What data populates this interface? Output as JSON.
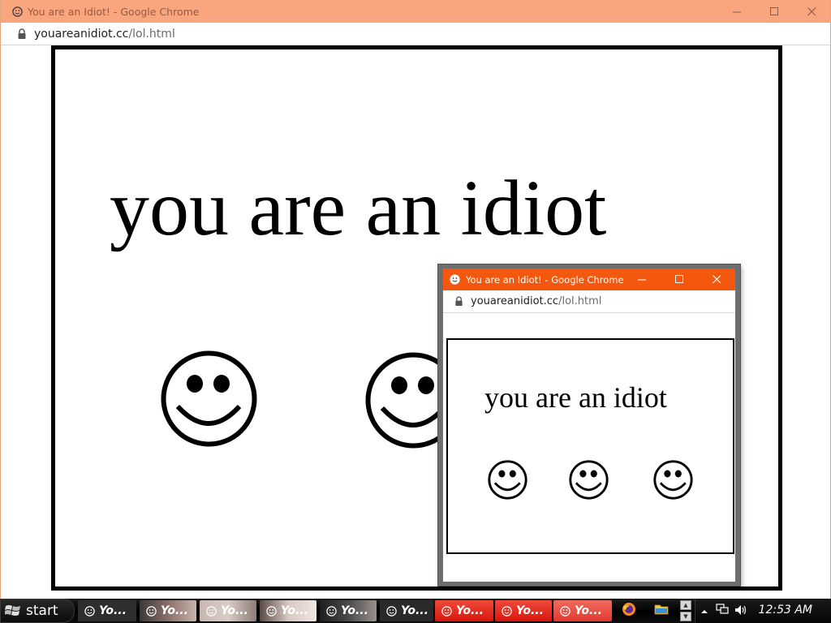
{
  "main_window": {
    "title": "You are an Idiot! - Google Chrome",
    "url_host": "youareanidiot.cc",
    "url_path": "/lol.html",
    "message": "you are an idiot"
  },
  "popup_window": {
    "title": "You are an Idiot! - Google Chrome",
    "url_host": "youareanidiot.cc",
    "url_path": "/lol.html",
    "message": "you are an idiot"
  },
  "taskbar": {
    "start_label": "start",
    "tasks": [
      {
        "label": "Yo...",
        "active": false
      },
      {
        "label": "Yo...",
        "active": false
      },
      {
        "label": "Yo...",
        "active": false
      },
      {
        "label": "Yo...",
        "active": false
      },
      {
        "label": "Yo...",
        "active": false
      },
      {
        "label": "Yo...",
        "active": false
      },
      {
        "label": "Yo...",
        "active": true
      },
      {
        "label": "Yo...",
        "active": true
      },
      {
        "label": "Yo...",
        "active": true
      }
    ],
    "clock": "12:53 AM"
  },
  "icons": {
    "window_icon": "smiley-icon",
    "lock": "lock-icon",
    "minimize": "minimize-icon",
    "maximize": "maximize-icon",
    "close": "close-icon",
    "start_logo": "windows-logo-icon",
    "firefox": "firefox-icon",
    "folder": "folder-icon",
    "tray_arrow": "tray-expand-icon",
    "network": "network-icon",
    "volume": "volume-icon"
  },
  "colors": {
    "main_titlebar": "#f9a57e",
    "popup_titlebar": "#f4580f",
    "active_task": "#e8251b"
  }
}
